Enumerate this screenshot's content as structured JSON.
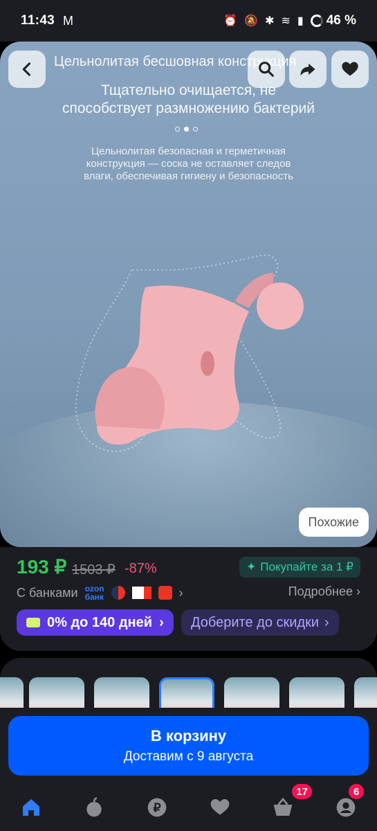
{
  "status_bar": {
    "time": "11:43",
    "battery": "46 %"
  },
  "hero": {
    "heading": "Цельнолитая бесшовная конструкция",
    "subtitle_line1": "Тщательно очищается, не",
    "subtitle_line2": "способствует размножению бактерий",
    "description_line1": "Цельнолитая безопасная и герметичная",
    "description_line2": "конструкция — соска не оставляет следов",
    "description_line3": "влаги, обеспечивая гигиену и безопасность",
    "similar_label": "Похожие",
    "pager_count": 3,
    "pager_active": 2
  },
  "product": {
    "price": "193 ₽",
    "old_price": "1503 ₽",
    "discount": "-87%",
    "buy_for": "Покупайте за 1 ₽",
    "banks_label": "С банками",
    "ozon_bank_line1": "ozon",
    "ozon_bank_line2": "банк",
    "more_label": "Подробнее",
    "installment": "0% до 140 дней",
    "add_to_discount": "Доберите до скидки"
  },
  "cart": {
    "button_label": "В корзину",
    "delivery": "Доставим с 9 августа"
  },
  "nav": {
    "cart_badge": "17",
    "profile_badge": "6"
  },
  "colors": {
    "price": "#34c759",
    "discount": "#ff4d7a",
    "primary": "#005bff",
    "installment": "#5a39e0",
    "badge": "#f91155"
  }
}
